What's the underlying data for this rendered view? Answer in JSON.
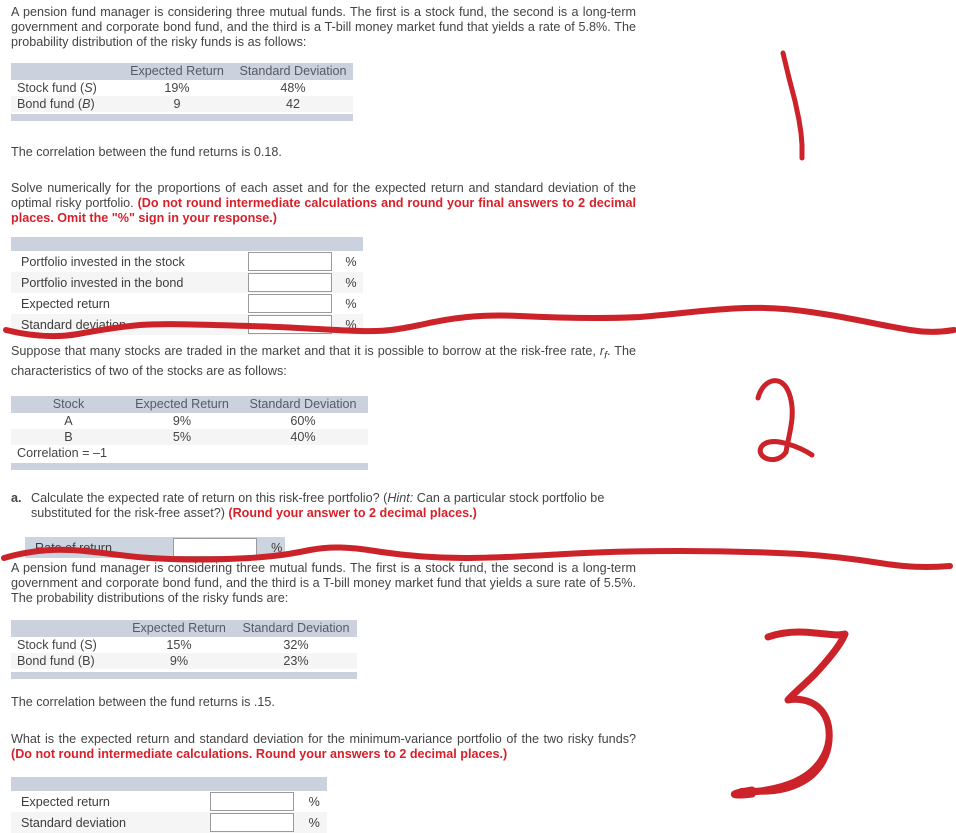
{
  "document": {
    "type": "finance-homework-worksheet"
  },
  "q1": {
    "prompt": "A pension fund manager is considering three mutual funds. The first is a stock fund, the second is a long-term government and corporate bond fund, and the third is a T-bill money market fund that yields a  rate of 5.8%. The probability distribution of the risky funds is as follows:",
    "table": {
      "headers": [
        "",
        "Expected Return",
        "Standard Deviation"
      ],
      "rows": [
        {
          "label": "Stock fund (S)",
          "label_plain": "Stock fund",
          "symbol": "S",
          "expected_return": "19%",
          "standard_deviation": "48%"
        },
        {
          "label": "Bond fund (B)",
          "label_plain": "Bond fund",
          "symbol": "B",
          "expected_return": "9",
          "standard_deviation": "42"
        }
      ]
    },
    "correlation_text": "The correlation between the fund returns is 0.18.",
    "instruction_plain": "Solve numerically for the proportions of each asset and for the expected return and standard deviation of the optimal risky portfolio. ",
    "instruction_red": "(Do not round intermediate calculations and round your final answers to 2 decimal places. Omit the \"%\" sign in your response.)",
    "answers": [
      {
        "label": "Portfolio invested in the stock",
        "value": "",
        "unit": "%"
      },
      {
        "label": "Portfolio invested in the bond",
        "value": "",
        "unit": "%"
      },
      {
        "label": "Expected return",
        "value": "",
        "unit": "%"
      },
      {
        "label": "Standard deviation",
        "value": "",
        "unit": "%"
      }
    ],
    "marker": "1"
  },
  "q2": {
    "prompt_part1": "Suppose that many stocks are traded in the market and that it is possible to borrow at the risk-free rate, ",
    "prompt_symbol_base": "r",
    "prompt_symbol_sub": "f",
    "prompt_part2": ". The characteristics of two of the stocks are as follows:",
    "table": {
      "headers": [
        "Stock",
        "Expected Return",
        "Standard Deviation"
      ],
      "rows": [
        {
          "stock": "A",
          "expected_return": "9%",
          "standard_deviation": "60%"
        },
        {
          "stock": "B",
          "expected_return": "5%",
          "standard_deviation": "40%"
        }
      ],
      "correlation_row": "Correlation = –1"
    },
    "question_letter": "a.",
    "question_plain": "Calculate the expected rate of return on this risk-free portfolio? (",
    "question_hint_italic": "Hint:",
    "question_hint_rest": " Can a particular stock portfolio be substituted for the risk-free asset?) ",
    "question_red": "(Round your answer to 2 decimal places.)",
    "answers": [
      {
        "label": "Rate of return",
        "value": "",
        "unit": "%"
      }
    ],
    "marker": "2"
  },
  "q3": {
    "prompt": "A pension fund manager is considering three mutual funds. The first is a stock fund, the second is a long-term government and corporate bond fund, and the third is a T-bill money market fund that yields a sure rate of 5.5%. The probability distributions of the risky funds are:",
    "table": {
      "headers": [
        "",
        "Expected Return",
        "Standard Deviation"
      ],
      "rows": [
        {
          "label": "Stock fund (S)",
          "expected_return": "15%",
          "standard_deviation": "32%"
        },
        {
          "label": "Bond fund (B)",
          "expected_return": "9%",
          "standard_deviation": "23%"
        }
      ]
    },
    "correlation_text": "The correlation between the fund returns is .15.",
    "instruction_plain": "What is the expected return and standard deviation for the minimum-variance portfolio of the two risky funds? ",
    "instruction_red": "(Do not round intermediate calculations. Round your answers to 2 decimal places.)",
    "answers": [
      {
        "label": "Expected return",
        "value": "",
        "unit": "%"
      },
      {
        "label": "Standard deviation",
        "value": "",
        "unit": "%"
      }
    ],
    "marker": "3"
  },
  "annotations": {
    "ink_color": "#cc2229",
    "markers": [
      "1",
      "2",
      "3"
    ],
    "separator_count": 2
  }
}
